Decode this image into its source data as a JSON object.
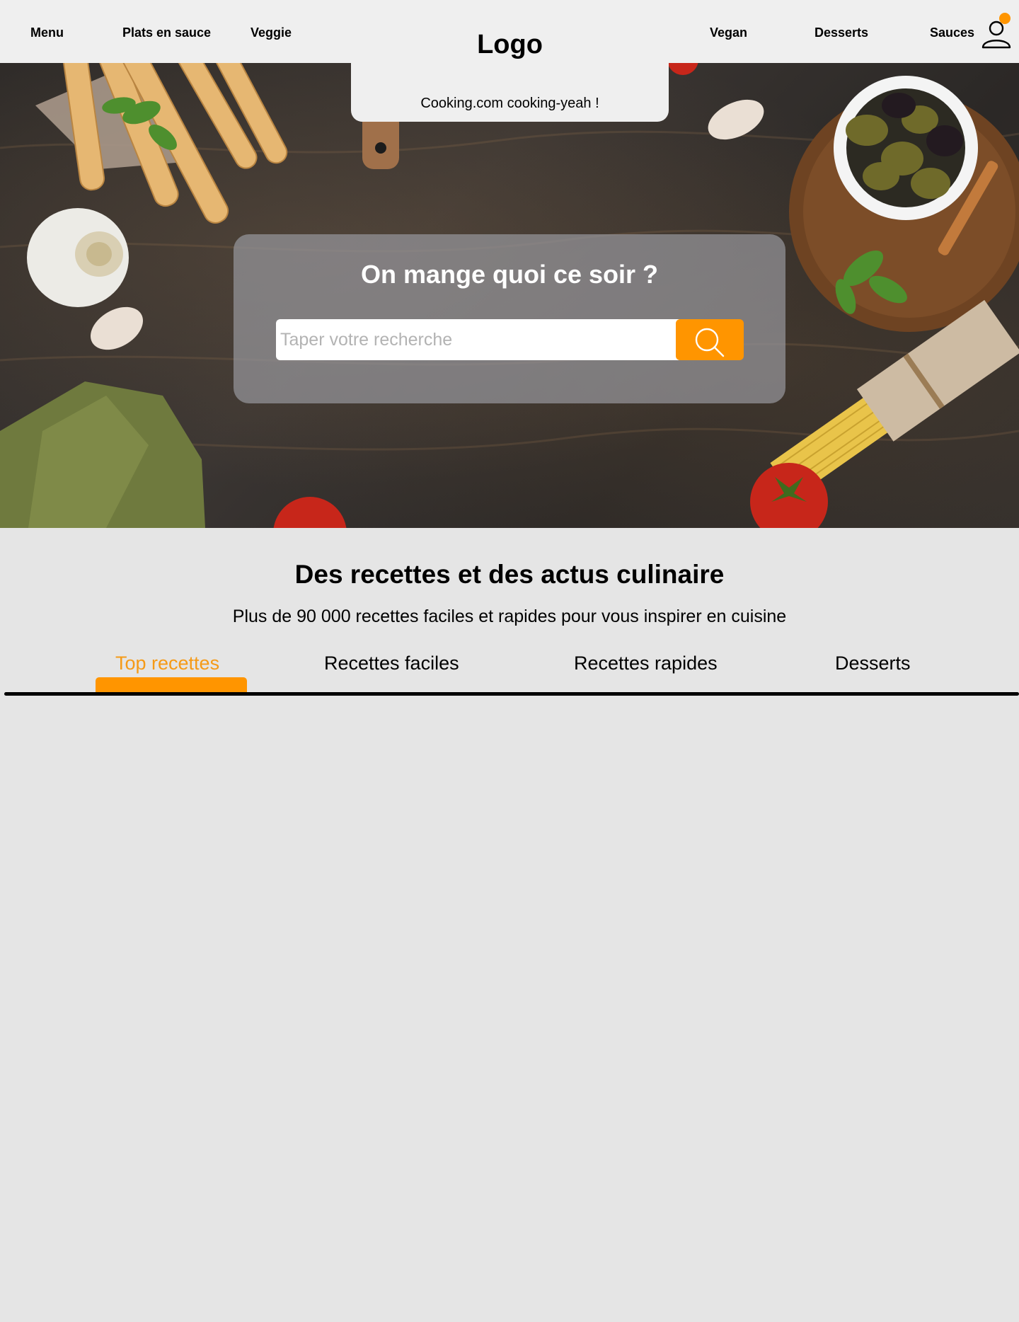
{
  "header": {
    "nav_left": [
      "Menu",
      "Plats en sauce",
      "Veggie"
    ],
    "nav_right": [
      "Vegan",
      "Desserts",
      "Sauces"
    ],
    "logo": "Logo",
    "tagline": "Cooking.com cooking-yeah !",
    "user_icon": "user-icon",
    "notification_color": "#ff9500"
  },
  "hero": {
    "title": "On mange quoi ce soir ?",
    "search": {
      "placeholder": "Taper votre recherche",
      "value": "",
      "button_icon": "search-icon"
    }
  },
  "section": {
    "title": "Des recettes et des actus culinaire",
    "subtitle": "Plus de 90 000 recettes faciles et rapides pour vous inspirer en cuisine",
    "tabs": [
      "Top recettes",
      "Recettes faciles",
      "Recettes rapides",
      "Desserts"
    ],
    "active_tab": "Top recettes"
  },
  "colors": {
    "accent": "#ff9500",
    "active_tab_text": "#f59a17",
    "header_bg": "#efefef",
    "page_bg": "#e5e5e5"
  }
}
